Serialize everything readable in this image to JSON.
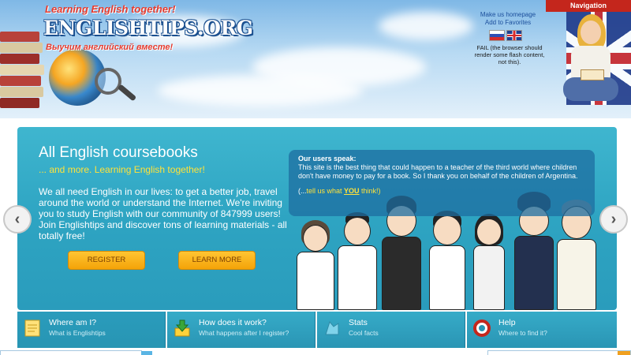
{
  "header": {
    "logo_tagline_top": "Learning English together!",
    "logo_text": "ENGLISHTIPS.ORG",
    "logo_tagline_bottom": "Выучим английский вместе!",
    "make_homepage": "Make us homepage",
    "add_favorites": "Add to Favorites",
    "fail_message": "FAIL (the browser should render some flash content, not this).",
    "navigation_label": "Navigation"
  },
  "slide": {
    "title": "All English coursebooks",
    "subtitle": "... and more. Learning English together!",
    "body": "We all need English in our lives: to get a better job, travel around the world or understand the Internet. We're inviting you to study English with our community of 847999 users! Join Englishtips and discover tons of learning materials - all totally free!",
    "register_label": "REGISTER",
    "learn_more_label": "LEARN MORE",
    "users_speak_title": "Our users speak:",
    "testimonial": "This site is the best thing that could happen to a teacher of the third world where children don't have money to pay for a book. So I thank you on behalf of the children of Argentina.",
    "cta_prefix": "(...",
    "cta_link": "tell us what ",
    "cta_you": "YOU",
    "cta_suffix": " think!)"
  },
  "tabs": [
    {
      "title": "Where am I?",
      "subtitle": "What is Englishtips",
      "icon": "notepad-icon"
    },
    {
      "title": "How does it work?",
      "subtitle": "What happens after I register?",
      "icon": "download-icon"
    },
    {
      "title": "Stats",
      "subtitle": "Cool facts",
      "icon": "stats-icon"
    },
    {
      "title": "Help",
      "subtitle": "Where to find it?",
      "icon": "lifebuoy-icon"
    }
  ],
  "colors": {
    "slider_bg": "#2ea4c2",
    "accent_yellow": "#ffe23a",
    "button_orange": "#f4a308",
    "nav_red": "#c4261c"
  }
}
